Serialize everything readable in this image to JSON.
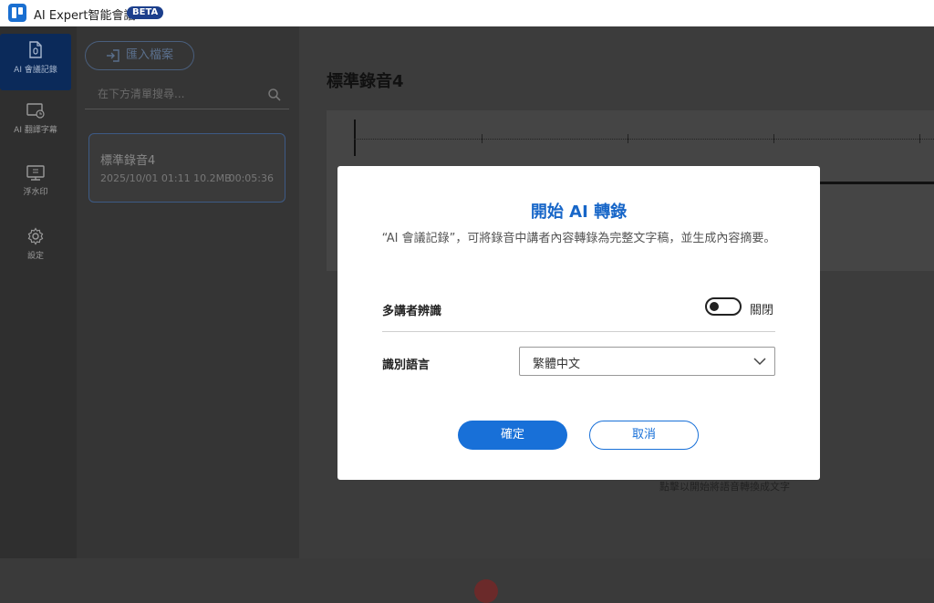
{
  "app": {
    "title": "AI Expert智能會議",
    "badge": "BETA"
  },
  "sidebar": {
    "items": [
      {
        "label": "AI 會議記錄",
        "icon": "document-mic-icon",
        "active": true
      },
      {
        "label": "AI 翻譯字幕",
        "icon": "monitor-clock-icon",
        "active": false
      },
      {
        "label": "浮水印",
        "icon": "monitor-stamp-icon",
        "active": false
      },
      {
        "label": "設定",
        "icon": "gear-icon",
        "active": false
      }
    ]
  },
  "list": {
    "import_label": "匯入檔案",
    "search_placeholder": "在下方清單搜尋...",
    "items": [
      {
        "title": "標準錄音4",
        "meta": "2025/10/01 01:11 10.2MB",
        "duration": "00:05:36"
      }
    ]
  },
  "main": {
    "title": "標準錄音4",
    "hint": "點擊以開始將語音轉換成文字"
  },
  "dialog": {
    "title": "開始 AI 轉錄",
    "description": "“AI 會議記錄”，可將錄音中講者內容轉錄為完整文字稿，並生成內容摘要。",
    "speaker_label": "多講者辨識",
    "speaker_toggle_state": "關閉",
    "language_label": "識別語言",
    "language_value": "繁體中文",
    "confirm_label": "確定",
    "cancel_label": "取消"
  },
  "colors": {
    "accent": "#1870d8",
    "title_blue": "#1766c8",
    "badge": "#1c3f8c"
  }
}
